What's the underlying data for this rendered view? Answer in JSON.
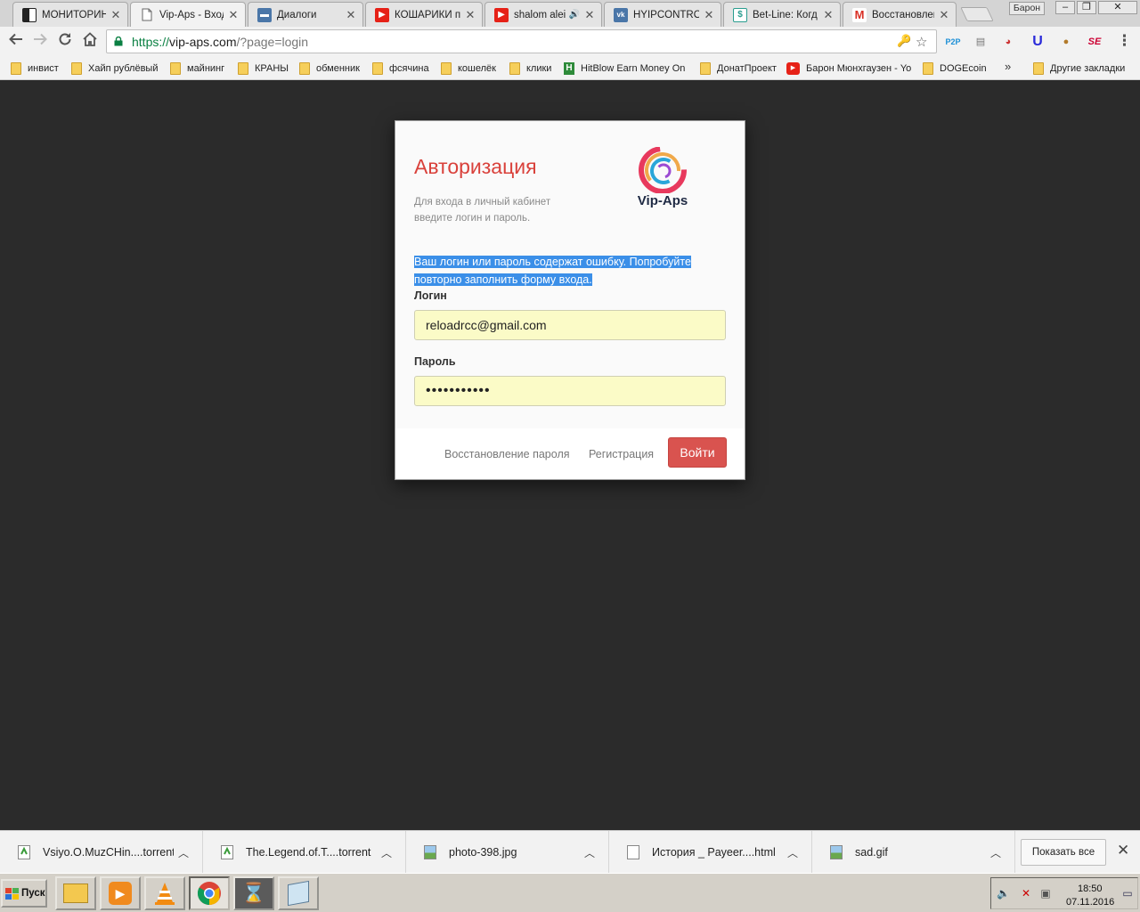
{
  "browser": {
    "tabs": [
      {
        "title": "МОНИТОРИНГ",
        "icon": "checker-icon",
        "color": "#222222"
      },
      {
        "title": "Vip-Aps - Вход",
        "icon": "page-icon",
        "color": "#777777",
        "active": true
      },
      {
        "title": "Диалоги",
        "icon": "chat-icon",
        "color": "#4a76a8"
      },
      {
        "title": "КОШАРИКИ пр",
        "icon": "youtube-icon",
        "color": "#e62117"
      },
      {
        "title": "shalom alei",
        "icon": "youtube-icon",
        "color": "#e62117"
      },
      {
        "title": "HYIPCONTROL",
        "icon": "vk-icon",
        "color": "#4a76a8"
      },
      {
        "title": "Bet-Line: Когд",
        "icon": "dollar-icon",
        "color": "#2a9d8f"
      },
      {
        "title": "Восстановлен",
        "icon": "gmail-icon",
        "color": "#d93025"
      }
    ],
    "profile_name": "Барон",
    "url": {
      "scheme": "https://",
      "host": "vip-aps.com",
      "path": "/?page=login"
    },
    "bookmarks": [
      {
        "label": "инвист"
      },
      {
        "label": "Хайп рублёвый"
      },
      {
        "label": "майнинг"
      },
      {
        "label": "КРАНЫ"
      },
      {
        "label": "обменник"
      },
      {
        "label": "фсячина"
      },
      {
        "label": "кошелёк"
      },
      {
        "label": "клики"
      },
      {
        "label": "HitBlow Earn Money On"
      },
      {
        "label": "ДонатПроект"
      },
      {
        "label": "Барон Мюнхгаузен - Yo"
      },
      {
        "label": "DOGEcoin"
      }
    ],
    "bookmarks_overflow": "»",
    "other_bookmarks": "Другие закладки"
  },
  "login_card": {
    "title": "Авторизация",
    "subtitle_line1": "Для входа в личный кабинет",
    "subtitle_line2": "введите логин и пароль.",
    "logo_text": "Vip-Aps",
    "error_line1": "Ваш логин или пароль содержат ошибку. Попробуйте",
    "error_line2": "повторно заполнить форму входа.",
    "login_label": "Логин",
    "login_value": "reloadrcc@gmail.com",
    "password_label": "Пароль",
    "password_value": "•••••••••••",
    "recover_link": "Восстановление пароля",
    "register_link": "Регистрация",
    "submit_label": "Войти",
    "accent_color": "#d9534f"
  },
  "downloads": {
    "items": [
      {
        "name": "Vsiyo.O.MuzCHin....torrent",
        "icon": "torrent-file-icon"
      },
      {
        "name": "The.Legend.of.T....torrent",
        "icon": "torrent-file-icon"
      },
      {
        "name": "photo-398.jpg",
        "icon": "image-file-icon"
      },
      {
        "name": "История _ Payeer....html",
        "icon": "html-file-icon"
      },
      {
        "name": "sad.gif",
        "icon": "image-file-icon"
      }
    ],
    "show_all_label": "Показать все"
  },
  "taskbar": {
    "start_label": "Пуск",
    "time": "18:50",
    "date": "07.11.2016"
  }
}
